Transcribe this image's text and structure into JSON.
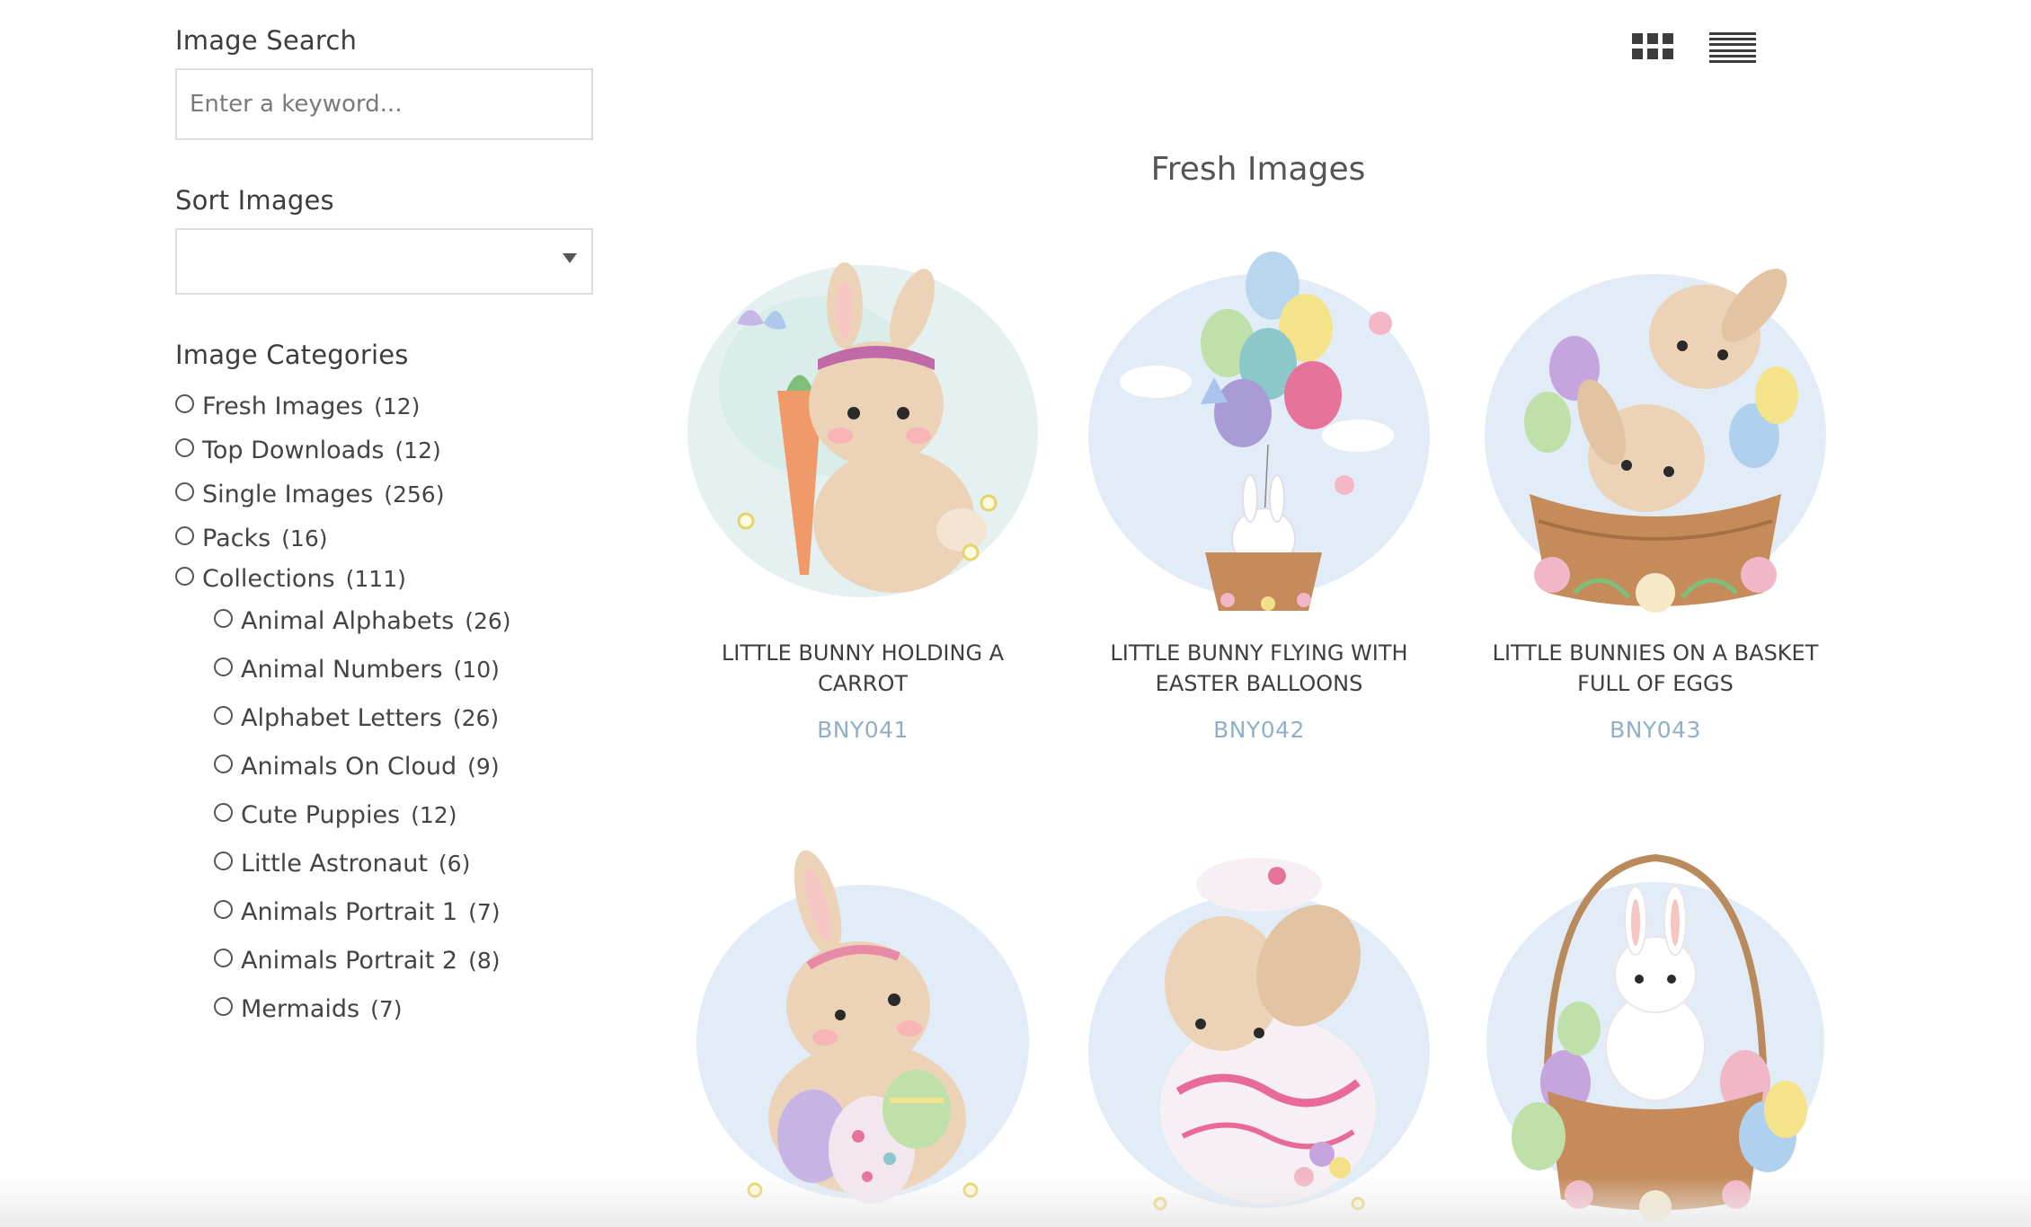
{
  "sidebar": {
    "search": {
      "title": "Image Search",
      "placeholder": "Enter a keyword..."
    },
    "sort": {
      "title": "Sort Images",
      "selected": ""
    },
    "categories": {
      "title": "Image Categories",
      "items": [
        {
          "label": "Fresh Images",
          "count": "(12)"
        },
        {
          "label": "Top Downloads",
          "count": "(12)"
        },
        {
          "label": "Single Images",
          "count": "(256)"
        },
        {
          "label": "Packs",
          "count": "(16)"
        },
        {
          "label": "Collections",
          "count": "(111)"
        }
      ],
      "sub_items": [
        {
          "label": "Animal Alphabets",
          "count": "(26)"
        },
        {
          "label": "Animal Numbers",
          "count": "(10)"
        },
        {
          "label": "Alphabet Letters",
          "count": "(26)"
        },
        {
          "label": "Animals On Cloud",
          "count": "(9)"
        },
        {
          "label": "Cute Puppies",
          "count": "(12)"
        },
        {
          "label": "Little Astronaut",
          "count": "(6)"
        },
        {
          "label": "Animals Portrait 1",
          "count": "(7)"
        },
        {
          "label": "Animals Portrait 2",
          "count": "(8)"
        },
        {
          "label": "Mermaids",
          "count": "(7)"
        }
      ]
    }
  },
  "view_toggle": {
    "grid_icon": "grid-view-icon",
    "list_icon": "list-view-icon"
  },
  "main": {
    "title": "Fresh Images",
    "cards": [
      {
        "title": "LITTLE BUNNY HOLDING A CARROT",
        "code": "BNY041"
      },
      {
        "title": "LITTLE BUNNY FLYING WITH EASTER BALLOONS",
        "code": "BNY042"
      },
      {
        "title": "LITTLE BUNNIES ON A BASKET FULL OF EGGS",
        "code": "BNY043"
      },
      {
        "title": "",
        "code": ""
      },
      {
        "title": "",
        "code": ""
      },
      {
        "title": "",
        "code": ""
      }
    ]
  },
  "colors": {
    "code_link": "#8fb0c6",
    "text": "#444444",
    "border": "#dcdcdc"
  }
}
